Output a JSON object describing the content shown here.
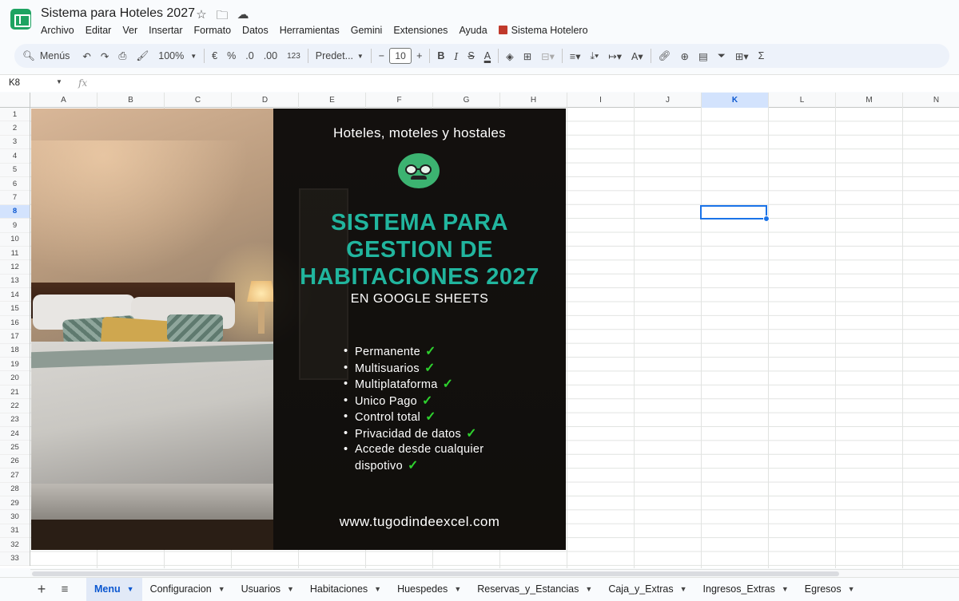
{
  "doc": {
    "title": "Sistema para Hoteles 2027",
    "icons": [
      "star-icon",
      "folder-move-icon",
      "cloud-saved-icon"
    ]
  },
  "menu": [
    "Archivo",
    "Editar",
    "Ver",
    "Insertar",
    "Formato",
    "Datos",
    "Herramientas",
    "Gemini",
    "Extensiones",
    "Ayuda"
  ],
  "extension_menu": "Sistema Hotelero",
  "toolbar": {
    "search": "Menús",
    "zoom": "100%",
    "currency": "€",
    "percent": "%",
    "dec_less": ".0",
    "dec_more": ".00",
    "number_format": "123",
    "font": "Predet...",
    "font_size": "10",
    "bold": "B",
    "italic": "I",
    "strike": "S",
    "text_color": "A",
    "sigma": "Σ"
  },
  "formula_bar": {
    "cell_ref": "K8",
    "fx": "fx",
    "value": ""
  },
  "columns": [
    "A",
    "B",
    "C",
    "D",
    "E",
    "F",
    "G",
    "H",
    "I",
    "J",
    "K",
    "L",
    "M",
    "N"
  ],
  "selected_column": "K",
  "rows": [
    "1",
    "2",
    "3",
    "4",
    "5",
    "6",
    "7",
    "8",
    "9",
    "10",
    "11",
    "12",
    "13",
    "14",
    "15",
    "16",
    "17",
    "18",
    "19",
    "20",
    "21",
    "22",
    "23",
    "24",
    "25",
    "26",
    "27",
    "28",
    "29",
    "30",
    "31",
    "32",
    "33"
  ],
  "selected_row": "8",
  "banner": {
    "subtitle": "Hoteles, moteles y hostales",
    "title_lines": [
      "SISTEMA PARA",
      "GESTION DE",
      "HABITACIONES 2027"
    ],
    "title2": "EN GOOGLE SHEETS",
    "features": [
      "Permanente",
      "Multisuarios",
      "Multiplataforma",
      "Unico Pago",
      "Control total",
      "Privacidad de datos",
      "Accede desde cualquier"
    ],
    "features_last_line": "dispotivo",
    "checkmark": "✓",
    "url": "www.tugodindeexcel.com",
    "accent_color": "#21b59e"
  },
  "sheets": [
    {
      "label": "Menu",
      "active": true
    },
    {
      "label": "Configuracion",
      "active": false
    },
    {
      "label": "Usuarios",
      "active": false
    },
    {
      "label": "Habitaciones",
      "active": false
    },
    {
      "label": "Huespedes",
      "active": false
    },
    {
      "label": "Reservas_y_Estancias",
      "active": false
    },
    {
      "label": "Caja_y_Extras",
      "active": false
    },
    {
      "label": "Ingresos_Extras",
      "active": false
    },
    {
      "label": "Egresos",
      "active": false
    }
  ]
}
